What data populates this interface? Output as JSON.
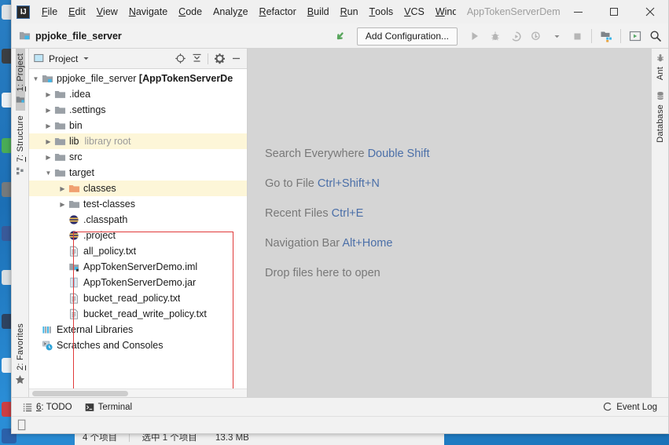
{
  "window": {
    "app_logo": "IJ",
    "title": "AppTokenServerDem",
    "minimize": "minimize-icon",
    "maximize": "maximize-icon",
    "close": "close-icon"
  },
  "menu": {
    "items": [
      {
        "label": "File",
        "mnemonic": "F"
      },
      {
        "label": "Edit",
        "mnemonic": "E"
      },
      {
        "label": "View",
        "mnemonic": "V"
      },
      {
        "label": "Navigate",
        "mnemonic": "N"
      },
      {
        "label": "Code",
        "mnemonic": "C"
      },
      {
        "label": "Analyze",
        "mnemonic": "A"
      },
      {
        "label": "Refactor",
        "mnemonic": "R"
      },
      {
        "label": "Build",
        "mnemonic": "B"
      },
      {
        "label": "Run",
        "mnemonic": "R"
      },
      {
        "label": "Tools",
        "mnemonic": "T"
      },
      {
        "label": "VCS",
        "mnemonic": "V"
      },
      {
        "label": "Windo",
        "mnemonic": "W"
      }
    ]
  },
  "navbar": {
    "project_name": "ppjoke_file_server",
    "add_configuration": "Add Configuration...",
    "vcs_icon": "vcs-update-arrow-icon",
    "buttons": [
      {
        "name": "run-button",
        "label": "Run"
      },
      {
        "name": "debug-button",
        "label": "Debug"
      },
      {
        "name": "run-with-coverage-button",
        "label": "Run with Coverage"
      },
      {
        "name": "profile-button",
        "label": "Profile"
      },
      {
        "name": "stop-button",
        "label": "Stop"
      },
      {
        "name": "project-structure-button",
        "label": "Project Structure"
      },
      {
        "name": "select-run-config-button",
        "label": "Select Run Configuration"
      },
      {
        "name": "search-everywhere-button",
        "label": "Search Everywhere"
      }
    ]
  },
  "left_strip": {
    "items": [
      {
        "name": "sidebar-item-project",
        "label": "1: Project",
        "mnemonic": "1",
        "icon": "project-folder-icon",
        "active": true
      },
      {
        "name": "sidebar-item-structure",
        "label": "7: Structure",
        "mnemonic": "7",
        "icon": "structure-grid-icon",
        "active": false
      }
    ],
    "bottom": {
      "name": "sidebar-item-favorites",
      "label": "2: Favorites",
      "mnemonic": "2",
      "icon": "star-icon"
    }
  },
  "right_strip": {
    "items": [
      {
        "name": "sidebar-item-ant",
        "label": "Ant",
        "icon": "ant-bug-icon"
      },
      {
        "name": "sidebar-item-database",
        "label": "Database",
        "icon": "database-icon"
      }
    ]
  },
  "project_panel": {
    "title": "Project",
    "dropdown_icon": "chevron-down-icon",
    "actions": [
      {
        "name": "select-opened-file-button",
        "icon": "crosshair-target-icon"
      },
      {
        "name": "collapse-all-button",
        "icon": "collapse-all-icon"
      },
      {
        "name": "panel-settings-button",
        "icon": "gear-icon"
      },
      {
        "name": "hide-panel-button",
        "icon": "minimize-icon"
      }
    ],
    "tree": [
      {
        "name": "tree-row-project-root",
        "depth": 0,
        "arrow": "down",
        "icon": "module-folder-icon",
        "label": "ppjoke_file_server ",
        "suffix": "[AppTokenServerDe",
        "suffix_bold": true,
        "highlight": false
      },
      {
        "name": "tree-row-idea",
        "depth": 1,
        "arrow": "right",
        "icon": "folder-icon",
        "label": ".idea",
        "highlight": false
      },
      {
        "name": "tree-row-settings",
        "depth": 1,
        "arrow": "right",
        "icon": "folder-icon",
        "label": ".settings",
        "highlight": false
      },
      {
        "name": "tree-row-bin",
        "depth": 1,
        "arrow": "right",
        "icon": "folder-icon",
        "label": "bin",
        "highlight": false
      },
      {
        "name": "tree-row-lib",
        "depth": 1,
        "arrow": "right",
        "icon": "folder-icon",
        "label": "lib",
        "muted": "library root",
        "highlight": true
      },
      {
        "name": "tree-row-src",
        "depth": 1,
        "arrow": "right",
        "icon": "folder-icon",
        "label": "src",
        "highlight": false
      },
      {
        "name": "tree-row-target",
        "depth": 1,
        "arrow": "down",
        "icon": "folder-icon",
        "label": "target",
        "highlight": false
      },
      {
        "name": "tree-row-classes",
        "depth": 2,
        "arrow": "right",
        "icon": "folder-excluded-icon",
        "label": "classes",
        "highlight": true
      },
      {
        "name": "tree-row-test-classes",
        "depth": 2,
        "arrow": "right",
        "icon": "folder-icon",
        "label": "test-classes",
        "highlight": false
      },
      {
        "name": "tree-row-classpath",
        "depth": 2,
        "arrow": "none",
        "icon": "eclipse-file-icon",
        "label": ".classpath",
        "highlight": false
      },
      {
        "name": "tree-row-project-file",
        "depth": 2,
        "arrow": "none",
        "icon": "eclipse-file-icon",
        "label": ".project",
        "highlight": false
      },
      {
        "name": "tree-row-all-policy",
        "depth": 2,
        "arrow": "none",
        "icon": "text-file-icon",
        "label": "all_policy.txt",
        "highlight": false
      },
      {
        "name": "tree-row-iml",
        "depth": 2,
        "arrow": "none",
        "icon": "iml-module-icon",
        "label": "AppTokenServerDemo.iml",
        "highlight": false
      },
      {
        "name": "tree-row-jar",
        "depth": 2,
        "arrow": "none",
        "icon": "jar-archive-icon",
        "label": "AppTokenServerDemo.jar",
        "highlight": false
      },
      {
        "name": "tree-row-bucket-read-policy",
        "depth": 2,
        "arrow": "none",
        "icon": "text-file-icon",
        "label": "bucket_read_policy.txt",
        "highlight": false
      },
      {
        "name": "tree-row-bucket-read-write-policy",
        "depth": 2,
        "arrow": "none",
        "icon": "text-file-icon",
        "label": "bucket_read_write_policy.txt",
        "highlight": false
      },
      {
        "name": "tree-row-external-libraries",
        "depth": 0,
        "arrow": "none",
        "icon": "libraries-icon",
        "label": "External Libraries",
        "highlight": false
      },
      {
        "name": "tree-row-scratches",
        "depth": 0,
        "arrow": "none",
        "icon": "scratches-icon",
        "label": "Scratches and Consoles",
        "highlight": false
      }
    ],
    "annotation": {
      "name": "red-highlight-box",
      "color": "#e03a3a"
    }
  },
  "editor": {
    "background": "#d5d5d5",
    "hints": [
      {
        "name": "hint-search-everywhere",
        "action": "Search Everywhere ",
        "shortcut": "Double Shift"
      },
      {
        "name": "hint-go-to-file",
        "action": "Go to File ",
        "shortcut": "Ctrl+Shift+N"
      },
      {
        "name": "hint-recent-files",
        "action": "Recent Files ",
        "shortcut": "Ctrl+E"
      },
      {
        "name": "hint-navigation-bar",
        "action": "Navigation Bar ",
        "shortcut": "Alt+Home"
      },
      {
        "name": "hint-drop-files",
        "action": "Drop files here to open",
        "shortcut": ""
      }
    ],
    "shortcut_color": "#4b6fa8"
  },
  "bottom_bar": {
    "left": [
      {
        "name": "bottom-tab-todo",
        "label": "6: TODO",
        "mnemonic": "6",
        "icon": "todo-list-icon"
      },
      {
        "name": "bottom-tab-terminal",
        "label": "Terminal",
        "icon": "terminal-icon"
      }
    ],
    "right": {
      "name": "event-log-button",
      "label": "Event Log",
      "icon": "event-log-icon"
    }
  },
  "status_bar": {
    "indicator": "memory-indicator-icon"
  },
  "explorer_behind": {
    "item_count": "4 个项目",
    "selection": "选中 1 个项目",
    "size": "13.3 MB"
  }
}
